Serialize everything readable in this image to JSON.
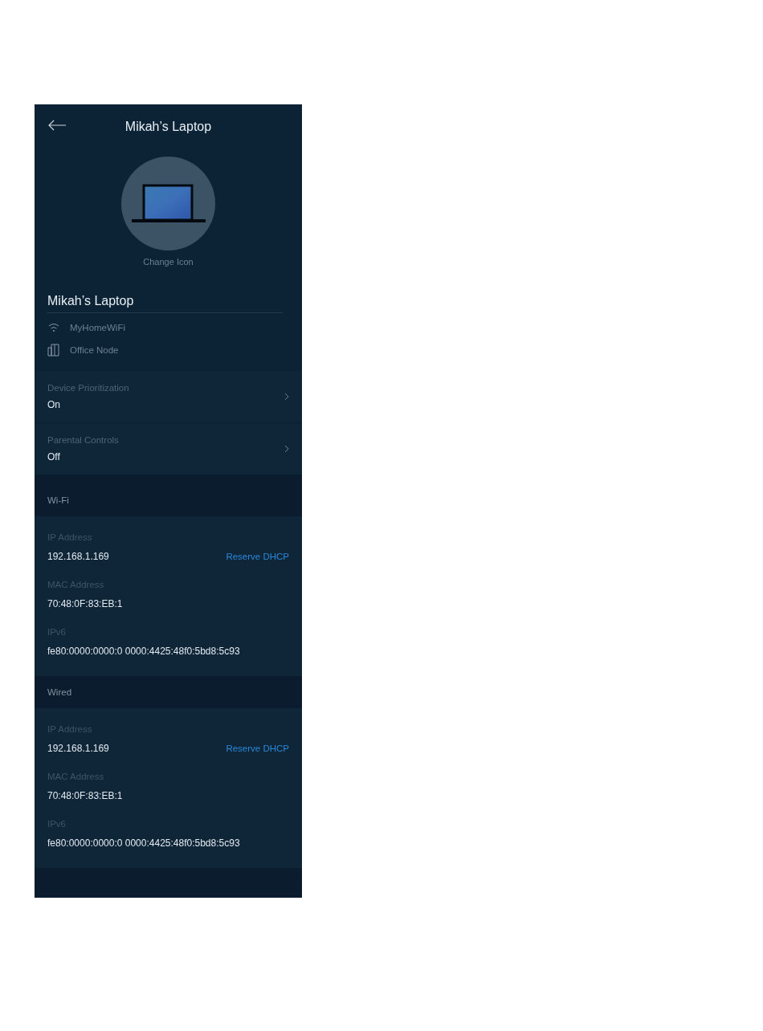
{
  "header": {
    "title": "Mikah’s Laptop"
  },
  "device": {
    "change_icon": "Change Icon",
    "name": "Mikah’s Laptop",
    "network": "MyHomeWiFi",
    "node": "Office Node"
  },
  "settings": [
    {
      "label": "Device Prioritization",
      "value": "On"
    },
    {
      "label": "Parental Controls",
      "value": "Off"
    }
  ],
  "connections": [
    {
      "title": "Wi-Fi",
      "fields": [
        {
          "label": "IP Address",
          "value": "192.168.1.169",
          "action": "Reserve DHCP"
        },
        {
          "label": "MAC Address",
          "value": "70:48:0F:83:EB:1"
        },
        {
          "label": "IPv6",
          "value": "fe80:0000:0000:0 0000:4425:48f0:5bd8:5c93"
        }
      ]
    },
    {
      "title": "Wired",
      "fields": [
        {
          "label": "IP Address",
          "value": "192.168.1.169",
          "action": "Reserve DHCP"
        },
        {
          "label": "MAC Address",
          "value": "70:48:0F:83:EB:1"
        },
        {
          "label": "IPv6",
          "value": "fe80:0000:0000:0 0000:4425:48f0:5bd8:5c93"
        }
      ]
    }
  ]
}
